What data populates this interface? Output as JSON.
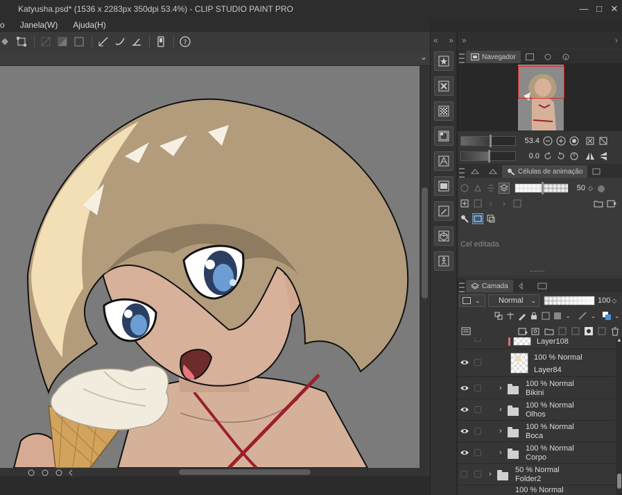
{
  "window": {
    "title": "Katyusha.psd* (1536 x 2283px 350dpi 53.4%)  - CLIP STUDIO PAINT PRO",
    "minimize": "—",
    "restore": "□",
    "close": "✕"
  },
  "menu": {
    "items": [
      "o",
      "Janela(W)",
      "Ajuda(H)"
    ]
  },
  "canvas": {
    "collapse_glyph": "⌄"
  },
  "icon_column": {
    "left_arrows": "«",
    "right_arrows": "»"
  },
  "panels": {
    "collapse_left": "»",
    "collapse_right": "›",
    "navigator": {
      "tab_label": "Navegador",
      "zoom_value": "53.4",
      "rotate_value": "0.0"
    },
    "animation": {
      "tab_label": "Células de animação",
      "opacity_value": "50",
      "cel_status": "Cel editada"
    },
    "layer": {
      "tab_label": "Camada",
      "blend_mode": "Normal",
      "opacity_value": "100",
      "rows": [
        {
          "line1": "Layer108",
          "line2": "",
          "type": "raster-partial"
        },
        {
          "line1": "100 % Normal",
          "line2": "Layer84",
          "type": "raster"
        },
        {
          "line1": "100 % Normal",
          "line2": "Bikini",
          "type": "folder"
        },
        {
          "line1": "100 % Normal",
          "line2": "Olhos",
          "type": "folder"
        },
        {
          "line1": "100 % Normal",
          "line2": "Boca",
          "type": "folder"
        },
        {
          "line1": "100 % Normal",
          "line2": "Corpo",
          "type": "folder"
        },
        {
          "line1": "50 % Normal",
          "line2": "Folder2",
          "type": "folder"
        },
        {
          "line1": "100 % Normal",
          "line2": "",
          "type": "folder"
        }
      ]
    }
  },
  "colors": {
    "accent": "#4a8fd6",
    "selection_red": "#e02020",
    "hair": "#b49d7d",
    "skin": "#d8b19a"
  }
}
